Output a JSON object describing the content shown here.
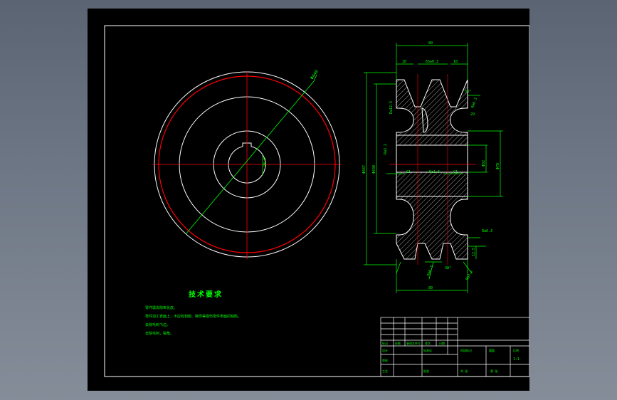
{
  "colors": {
    "background_gradient_top": "#5b6473",
    "viewport": "#000000",
    "frame": "#ffffff",
    "outline": "#ffffff",
    "center_line": "#ff0000",
    "dimension": "#00ff00",
    "hatch": "#ffffff"
  },
  "front_view": {
    "dia_label": "Φ440",
    "key_label": "28.3"
  },
  "section_view": {
    "dims": {
      "overall_width_top": "80",
      "groove_edge": "10",
      "groove_pitch": "65±0.3",
      "groove_edge_right": "10",
      "groove_angle": "38°",
      "groove_depth": "29",
      "roughness_groove": "Ra12.5",
      "roughness_top_right": "Ra6.3",
      "roughness_bore": "Ra1.6",
      "roughness_left": "Ra3.2",
      "roughness_hub": "Ra6.3",
      "chamfer_left": "C1",
      "chamfer_right": "C1",
      "outer_dia": "Φ447",
      "pitch_dia": "Φ430",
      "bore_dia": "Φ32",
      "hub_dia": "Φ70",
      "groove_bottom": "12.5",
      "groove_angle_bottom": "38°",
      "roughness_bottom_left": "Ra6.3",
      "roughness_bottom_right": "Ra3.2",
      "overall_width_bottom": "80"
    }
  },
  "tech_requirements": {
    "title": "技术要求",
    "lines": [
      "零件需去除氧化皮。",
      "零件加工表面上，不应有划痕、擦伤等损伤零件表面的缺陷。",
      "去除毛刺飞边。",
      "去除毛刺，锐角。"
    ]
  },
  "title_block": {
    "cells": [
      "标记",
      "处数",
      "更改文件号",
      "签字",
      "日期",
      "设计",
      "标准化",
      "审核",
      "工艺",
      "批准",
      "阶段标记",
      "重量",
      "比例",
      "1:1",
      "共 张",
      "第 张"
    ]
  }
}
